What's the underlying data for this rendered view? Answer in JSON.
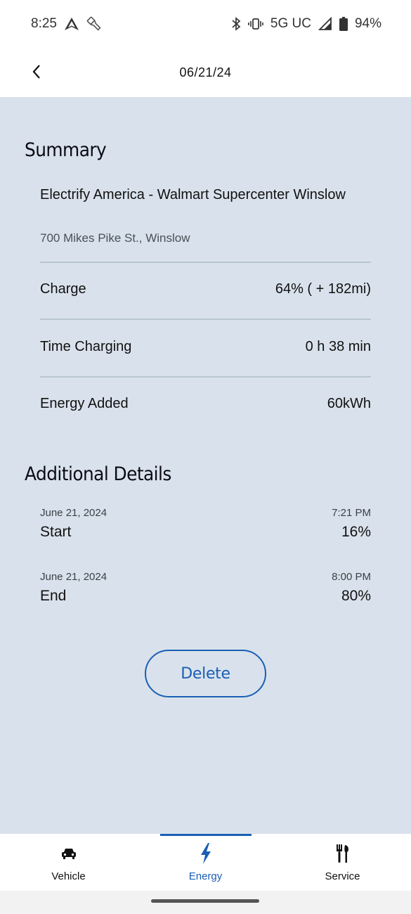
{
  "status_bar": {
    "time": "8:25",
    "network": "5G UC",
    "battery": "94%",
    "icons": [
      "navigation-icon",
      "flashlight-icon",
      "bluetooth-icon",
      "vibrate-icon",
      "signal-icon",
      "battery-icon"
    ]
  },
  "header": {
    "title": "06/21/24",
    "back_icon": "chevron-left-icon"
  },
  "summary": {
    "heading": "Summary",
    "station_name": "Electrify America - Walmart Supercenter Winslow",
    "address": "700 Mikes Pike St., Winslow",
    "rows": [
      {
        "label": "Charge",
        "value": "64% ( + 182mi)"
      },
      {
        "label": "Time Charging",
        "value": "0 h 38 min"
      },
      {
        "label": "Energy Added",
        "value": "60kWh"
      }
    ]
  },
  "additional_details": {
    "heading": "Additional Details",
    "entries": [
      {
        "date": "June 21, 2024",
        "time": "7:21 PM",
        "label": "Start",
        "value": "16%"
      },
      {
        "date": "June 21, 2024",
        "time": "8:00 PM",
        "label": "End",
        "value": "80%"
      }
    ]
  },
  "actions": {
    "delete_label": "Delete"
  },
  "bottom_nav": {
    "active": "Energy",
    "items": [
      {
        "label": "Vehicle",
        "icon": "car-icon"
      },
      {
        "label": "Energy",
        "icon": "lightning-icon"
      },
      {
        "label": "Service",
        "icon": "tools-icon"
      }
    ]
  },
  "colors": {
    "accent": "#1a5fb4",
    "content_background": "#d9e2ec",
    "divider": "#b8c5d2"
  }
}
